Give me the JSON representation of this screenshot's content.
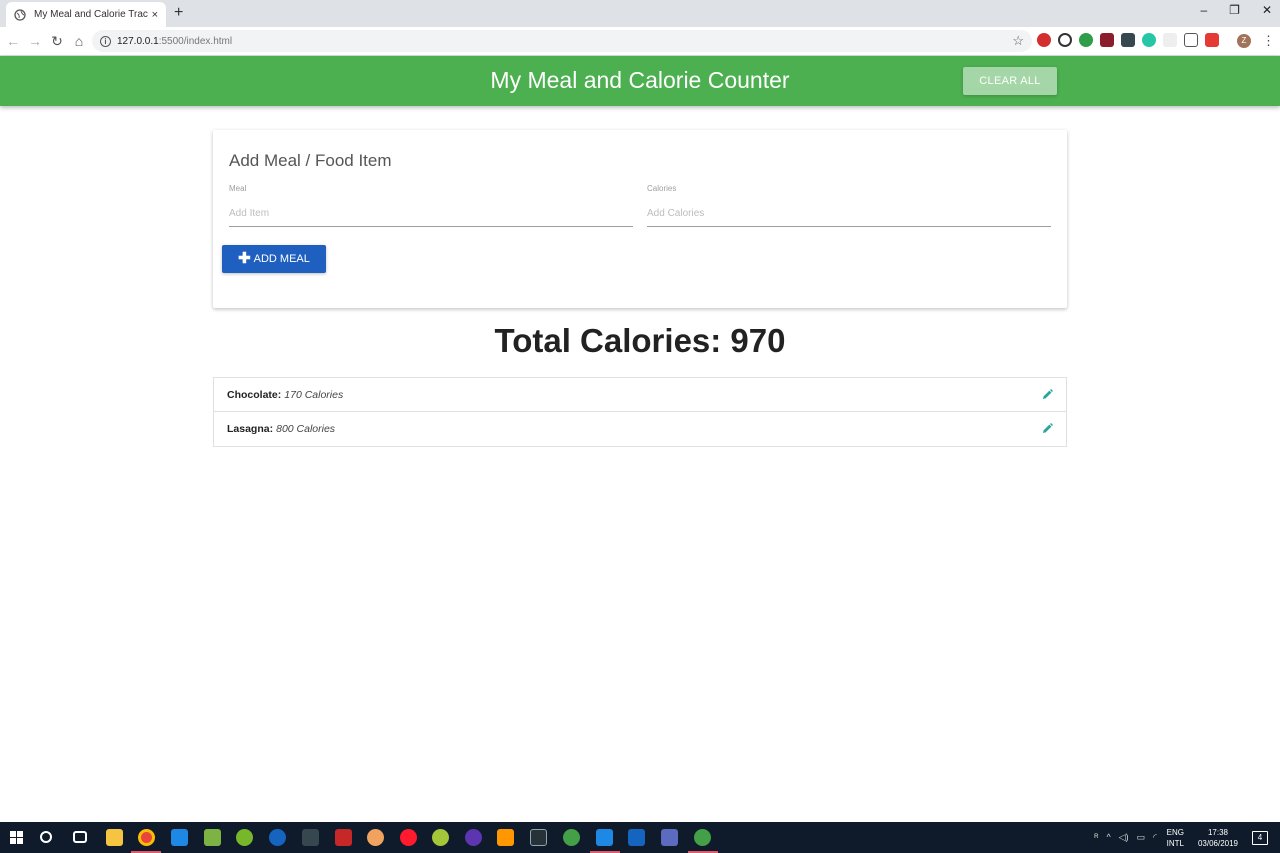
{
  "browser": {
    "tab_title": "My Meal and Calorie Tracker",
    "tab_close": "×",
    "new_tab": "+",
    "url_host": "127.0.0.1",
    "url_path": ":5500/index.html",
    "window_controls": {
      "minimize": "–",
      "restore": "❐",
      "close": "✕"
    },
    "profile_initial": "Z"
  },
  "header": {
    "title": "My Meal and Calorie Counter",
    "clear_label": "CLEAR ALL"
  },
  "form": {
    "title": "Add Meal / Food Item",
    "meal_label": "Meal",
    "meal_placeholder": "Add Item",
    "calories_label": "Calories",
    "calories_placeholder": "Add Calories",
    "add_label": "ADD MEAL"
  },
  "total": {
    "text": "Total Calories: 970"
  },
  "meals": [
    {
      "name": "Chocolate:",
      "calories": "170 Calories"
    },
    {
      "name": "Lasagna:",
      "calories": "800 Calories"
    }
  ],
  "taskbar": {
    "lang_top": "ENG",
    "lang_bottom": "INTL",
    "time": "17:38",
    "date": "03/06/2019",
    "notification_count": "4"
  },
  "colors": {
    "header_bg": "#4caf50",
    "clear_btn": "#a5d6a7",
    "add_btn": "#1e5fbf",
    "edit_icon": "#26a69a"
  }
}
